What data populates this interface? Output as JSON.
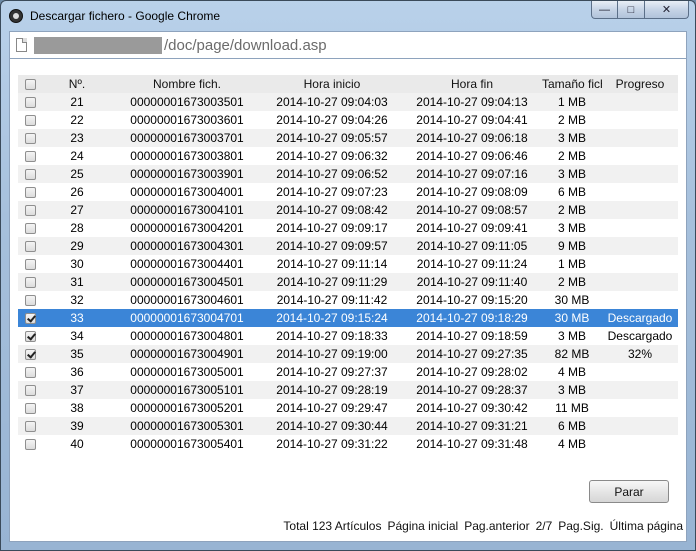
{
  "window": {
    "title": "Descargar fichero - Google Chrome",
    "minimize_glyph": "—",
    "maximize_glyph": "□",
    "close_glyph": "✕"
  },
  "address": {
    "url": "/doc/page/download.asp"
  },
  "table": {
    "headers": {
      "num": "Nº.",
      "name": "Nombre fich.",
      "start": "Hora inicio",
      "end": "Hora fin",
      "size": "Tamaño fichero",
      "progress": "Progreso"
    },
    "rows": [
      {
        "checked": false,
        "selected": false,
        "num": "21",
        "name": "00000001673003501",
        "start": "2014-10-27 09:04:03",
        "end": "2014-10-27 09:04:13",
        "size": "1 MB",
        "progress": ""
      },
      {
        "checked": false,
        "selected": false,
        "num": "22",
        "name": "00000001673003601",
        "start": "2014-10-27 09:04:26",
        "end": "2014-10-27 09:04:41",
        "size": "2 MB",
        "progress": ""
      },
      {
        "checked": false,
        "selected": false,
        "num": "23",
        "name": "00000001673003701",
        "start": "2014-10-27 09:05:57",
        "end": "2014-10-27 09:06:18",
        "size": "3 MB",
        "progress": ""
      },
      {
        "checked": false,
        "selected": false,
        "num": "24",
        "name": "00000001673003801",
        "start": "2014-10-27 09:06:32",
        "end": "2014-10-27 09:06:46",
        "size": "2 MB",
        "progress": ""
      },
      {
        "checked": false,
        "selected": false,
        "num": "25",
        "name": "00000001673003901",
        "start": "2014-10-27 09:06:52",
        "end": "2014-10-27 09:07:16",
        "size": "3 MB",
        "progress": ""
      },
      {
        "checked": false,
        "selected": false,
        "num": "26",
        "name": "00000001673004001",
        "start": "2014-10-27 09:07:23",
        "end": "2014-10-27 09:08:09",
        "size": "6 MB",
        "progress": ""
      },
      {
        "checked": false,
        "selected": false,
        "num": "27",
        "name": "00000001673004101",
        "start": "2014-10-27 09:08:42",
        "end": "2014-10-27 09:08:57",
        "size": "2 MB",
        "progress": ""
      },
      {
        "checked": false,
        "selected": false,
        "num": "28",
        "name": "00000001673004201",
        "start": "2014-10-27 09:09:17",
        "end": "2014-10-27 09:09:41",
        "size": "3 MB",
        "progress": ""
      },
      {
        "checked": false,
        "selected": false,
        "num": "29",
        "name": "00000001673004301",
        "start": "2014-10-27 09:09:57",
        "end": "2014-10-27 09:11:05",
        "size": "9 MB",
        "progress": ""
      },
      {
        "checked": false,
        "selected": false,
        "num": "30",
        "name": "00000001673004401",
        "start": "2014-10-27 09:11:14",
        "end": "2014-10-27 09:11:24",
        "size": "1 MB",
        "progress": ""
      },
      {
        "checked": false,
        "selected": false,
        "num": "31",
        "name": "00000001673004501",
        "start": "2014-10-27 09:11:29",
        "end": "2014-10-27 09:11:40",
        "size": "2 MB",
        "progress": ""
      },
      {
        "checked": false,
        "selected": false,
        "num": "32",
        "name": "00000001673004601",
        "start": "2014-10-27 09:11:42",
        "end": "2014-10-27 09:15:20",
        "size": "30 MB",
        "progress": ""
      },
      {
        "checked": true,
        "selected": true,
        "num": "33",
        "name": "00000001673004701",
        "start": "2014-10-27 09:15:24",
        "end": "2014-10-27 09:18:29",
        "size": "30 MB",
        "progress": "Descargado"
      },
      {
        "checked": true,
        "selected": false,
        "num": "34",
        "name": "00000001673004801",
        "start": "2014-10-27 09:18:33",
        "end": "2014-10-27 09:18:59",
        "size": "3 MB",
        "progress": "Descargado"
      },
      {
        "checked": true,
        "selected": false,
        "num": "35",
        "name": "00000001673004901",
        "start": "2014-10-27 09:19:00",
        "end": "2014-10-27 09:27:35",
        "size": "82 MB",
        "progress": "32%"
      },
      {
        "checked": false,
        "selected": false,
        "num": "36",
        "name": "00000001673005001",
        "start": "2014-10-27 09:27:37",
        "end": "2014-10-27 09:28:02",
        "size": "4 MB",
        "progress": ""
      },
      {
        "checked": false,
        "selected": false,
        "num": "37",
        "name": "00000001673005101",
        "start": "2014-10-27 09:28:19",
        "end": "2014-10-27 09:28:37",
        "size": "3 MB",
        "progress": ""
      },
      {
        "checked": false,
        "selected": false,
        "num": "38",
        "name": "00000001673005201",
        "start": "2014-10-27 09:29:47",
        "end": "2014-10-27 09:30:42",
        "size": "11 MB",
        "progress": ""
      },
      {
        "checked": false,
        "selected": false,
        "num": "39",
        "name": "00000001673005301",
        "start": "2014-10-27 09:30:44",
        "end": "2014-10-27 09:31:21",
        "size": "6 MB",
        "progress": ""
      },
      {
        "checked": false,
        "selected": false,
        "num": "40",
        "name": "00000001673005401",
        "start": "2014-10-27 09:31:22",
        "end": "2014-10-27 09:31:48",
        "size": "4 MB",
        "progress": ""
      }
    ]
  },
  "actions": {
    "stop_label": "Parar"
  },
  "pagination": {
    "total": "Total 123 Artículos",
    "first": "Página inicial",
    "prev": "Pag.anterior",
    "page": "2/7",
    "next": "Pag.Sig.",
    "last": "Última página"
  },
  "colors": {
    "selection": "#3b85d7",
    "header_bg": "#eaeaea",
    "row_alt": "#f1f1f1"
  }
}
